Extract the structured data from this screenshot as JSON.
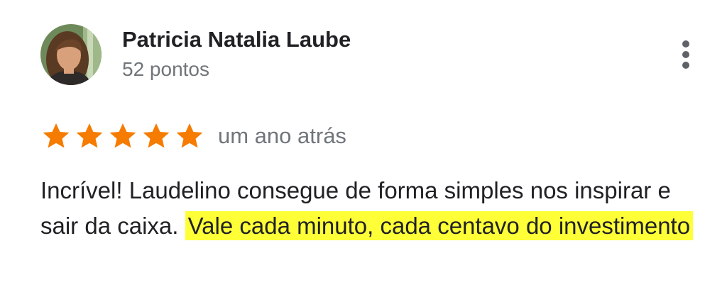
{
  "review": {
    "author": {
      "name": "Patricia Natalia Laube",
      "points": "52 pontos",
      "avatar": "profile-photo"
    },
    "menu_icon": "more-vert-icon",
    "rating": 5,
    "star_color": "#f57c00",
    "time": "um ano atrás",
    "text": {
      "plain": "Incrível! Laudelino consegue de forma simples nos inspirar e sair da caixa. ",
      "highlighted": "Vale cada minuto, cada centavo do investimento"
    },
    "highlight_color": "#ffff37"
  }
}
